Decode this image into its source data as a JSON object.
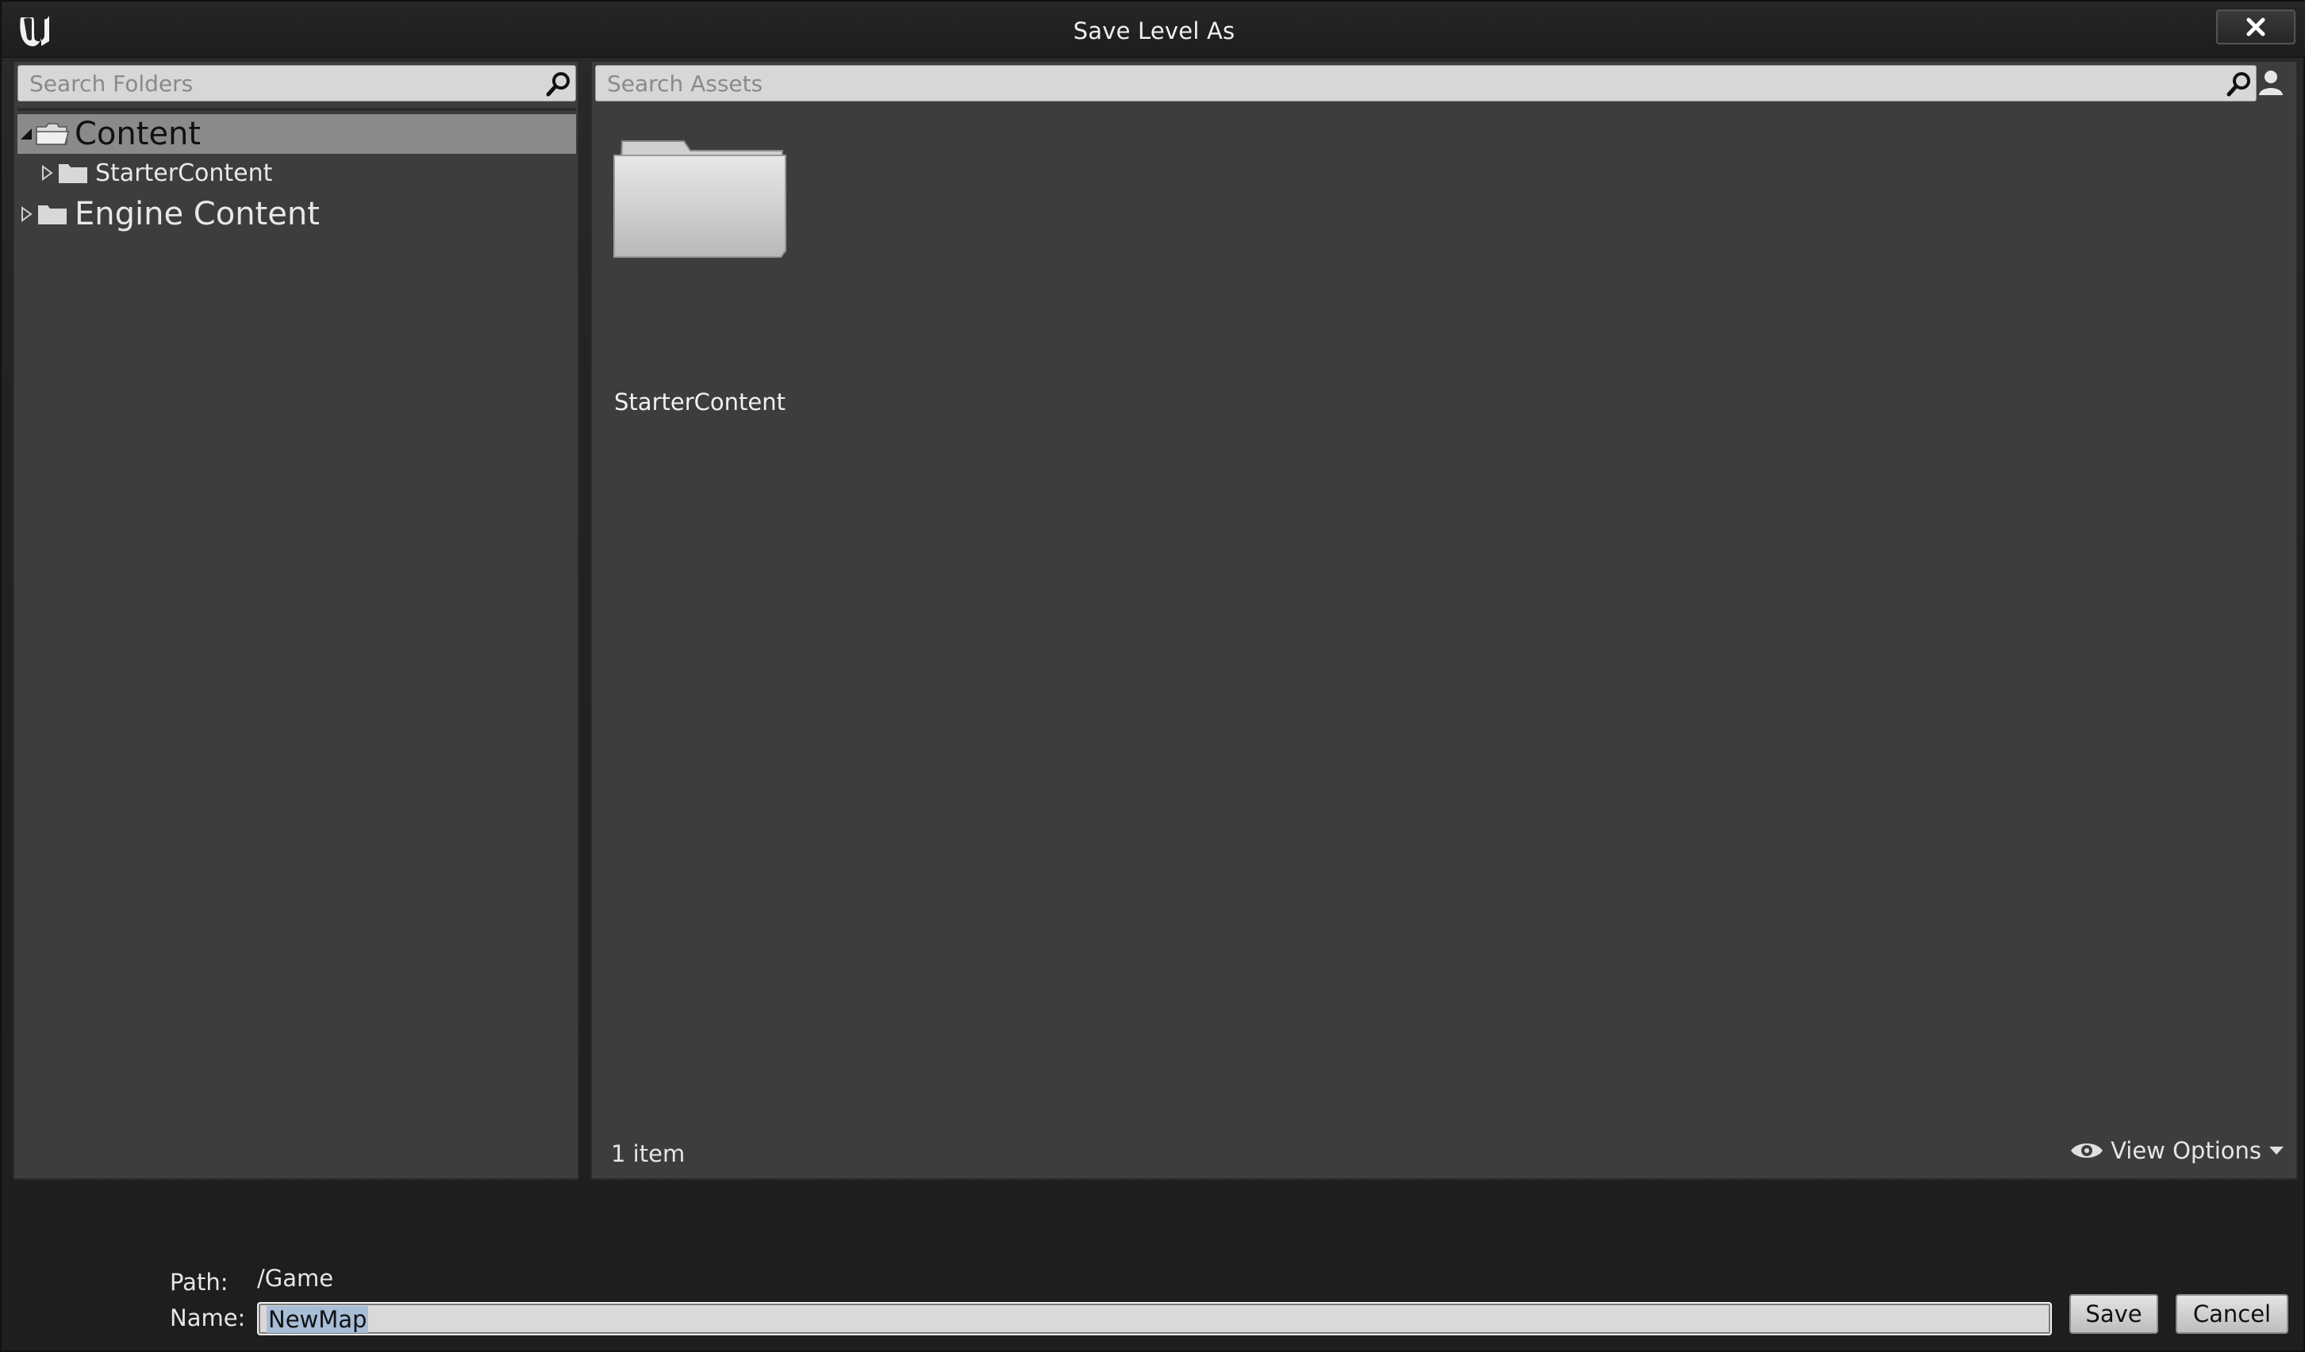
{
  "window": {
    "title": "Save Level As",
    "logo": "unreal-engine-logo"
  },
  "folder_panel": {
    "search_placeholder": "Search Folders",
    "tree": [
      {
        "label": "Content",
        "expanded": true,
        "selected": true,
        "level": 0
      },
      {
        "label": "StarterContent",
        "expanded": false,
        "selected": false,
        "level": 1
      },
      {
        "label": "Engine Content",
        "expanded": false,
        "selected": false,
        "level": 0
      }
    ]
  },
  "asset_panel": {
    "search_placeholder": "Search Assets",
    "assets": [
      {
        "label": "StarterContent",
        "type": "folder-icon"
      }
    ],
    "item_count": "1 item",
    "view_options_label": "View Options"
  },
  "footer": {
    "path_label": "Path:",
    "path_value": "/Game",
    "name_label": "Name:",
    "name_value": "NewMap",
    "save_label": "Save",
    "cancel_label": "Cancel"
  },
  "colors": {
    "panel_bg": "#3d3d3d",
    "selected_row": "#8a8a8a",
    "text_selection": "#a8bdd6"
  }
}
